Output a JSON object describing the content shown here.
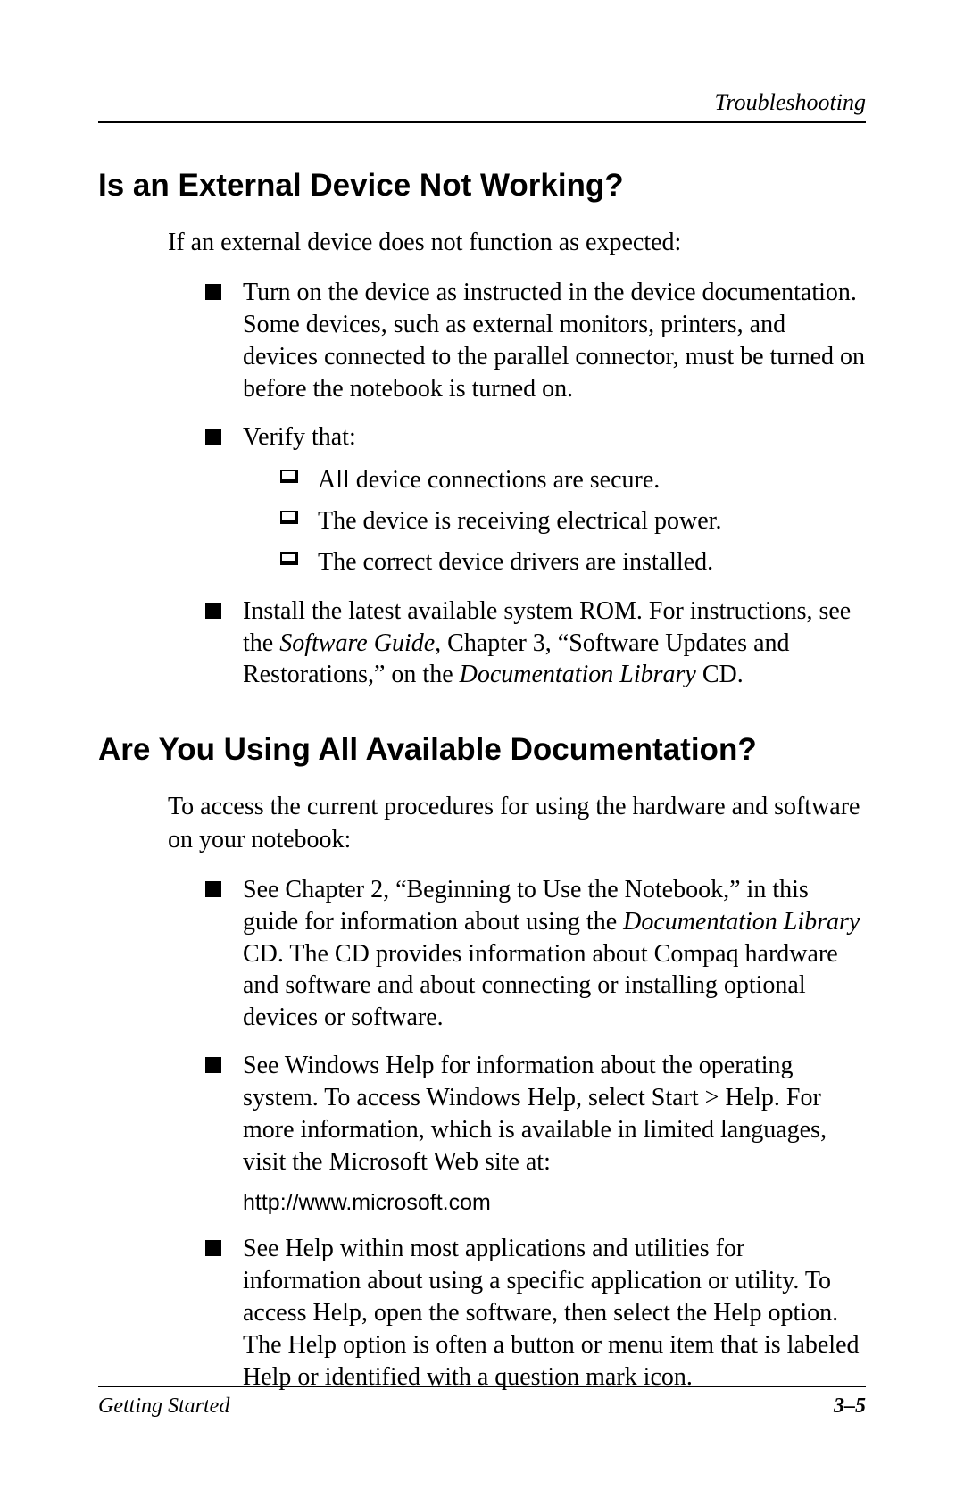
{
  "header": {
    "section": "Troubleshooting"
  },
  "section1": {
    "heading": "Is an External Device Not Working?",
    "intro": "If an external device does not function as expected:",
    "bullets": {
      "b1": "Turn on the device as instructed in the device documentation. Some devices, such as external monitors, printers, and devices connected to the parallel connector, must be turned on before the notebook is turned on.",
      "b2": "Verify that:",
      "b2_sub": {
        "s1": "All device connections are secure.",
        "s2": "The device is receiving electrical power.",
        "s3": "The correct device drivers are installed."
      },
      "b3_part1": "Install the latest available system ROM. For instructions, see the ",
      "b3_italic1": "Software Guide,",
      "b3_part2": " Chapter 3, “Software Updates and Restorations,” on the ",
      "b3_italic2": "Documentation Library",
      "b3_part3": " CD."
    }
  },
  "section2": {
    "heading": "Are You Using All Available Documentation?",
    "intro": "To access the current procedures for using the hardware and software on your notebook:",
    "bullets": {
      "b1_part1": "See Chapter 2, “Beginning to Use the Notebook,” in this guide for information about using the ",
      "b1_italic": "Documentation Library",
      "b1_part2": " CD. The CD provides information about Compaq hardware and software and about connecting or installing optional devices or software.",
      "b2": "See Windows Help for information about the operating system. To access Windows Help, select Start > Help. For more information, which is available in limited languages, visit the Microsoft Web site at:",
      "b2_url": "http://www.microsoft.com",
      "b3": "See Help within most applications and utilities for information about using a specific application or utility. To access Help, open the software, then select the Help option. The Help option is often a button or menu item that is labeled Help or identified with a question mark icon."
    }
  },
  "footer": {
    "left": "Getting Started",
    "right": "3–5"
  }
}
